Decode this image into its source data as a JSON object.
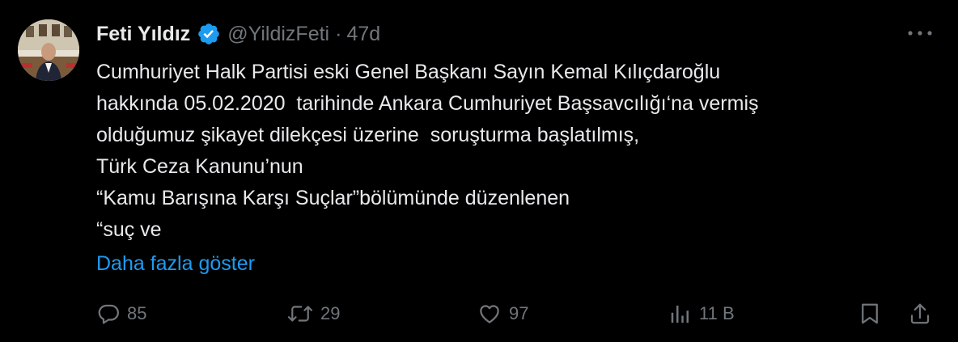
{
  "author": {
    "name": "Feti Yıldız",
    "handle": "@YildizFeti",
    "separator": "·",
    "time": "47d",
    "verified": true
  },
  "tweet": {
    "text": "Cumhuriyet Halk Partisi eski Genel Başkanı Sayın Kemal Kılıçdaroğlu\nhakkında 05.02.2020  tarihinde Ankara Cumhuriyet Başsavcılığı‘na vermiş\nolduğumuz şikayet dilekçesi üzerine  soruşturma başlatılmış,\nTürk Ceza Kanunu’nun\n“Kamu Barışına Karşı Suçlar”bölümünde düzenlenen\n“suç ve",
    "show_more": "Daha fazla göster"
  },
  "actions": {
    "replies": "85",
    "retweets": "29",
    "likes": "97",
    "views": "11 B"
  },
  "icons": {
    "verified": "verified-badge-icon",
    "more": "more-dots-icon",
    "reply": "reply-icon",
    "retweet": "retweet-icon",
    "like": "heart-icon",
    "views": "views-chart-icon",
    "bookmark": "bookmark-icon",
    "share": "share-icon"
  },
  "colors": {
    "background": "#000000",
    "text": "#e7e9ea",
    "secondary": "#71767b",
    "accent": "#1d9bf0"
  }
}
